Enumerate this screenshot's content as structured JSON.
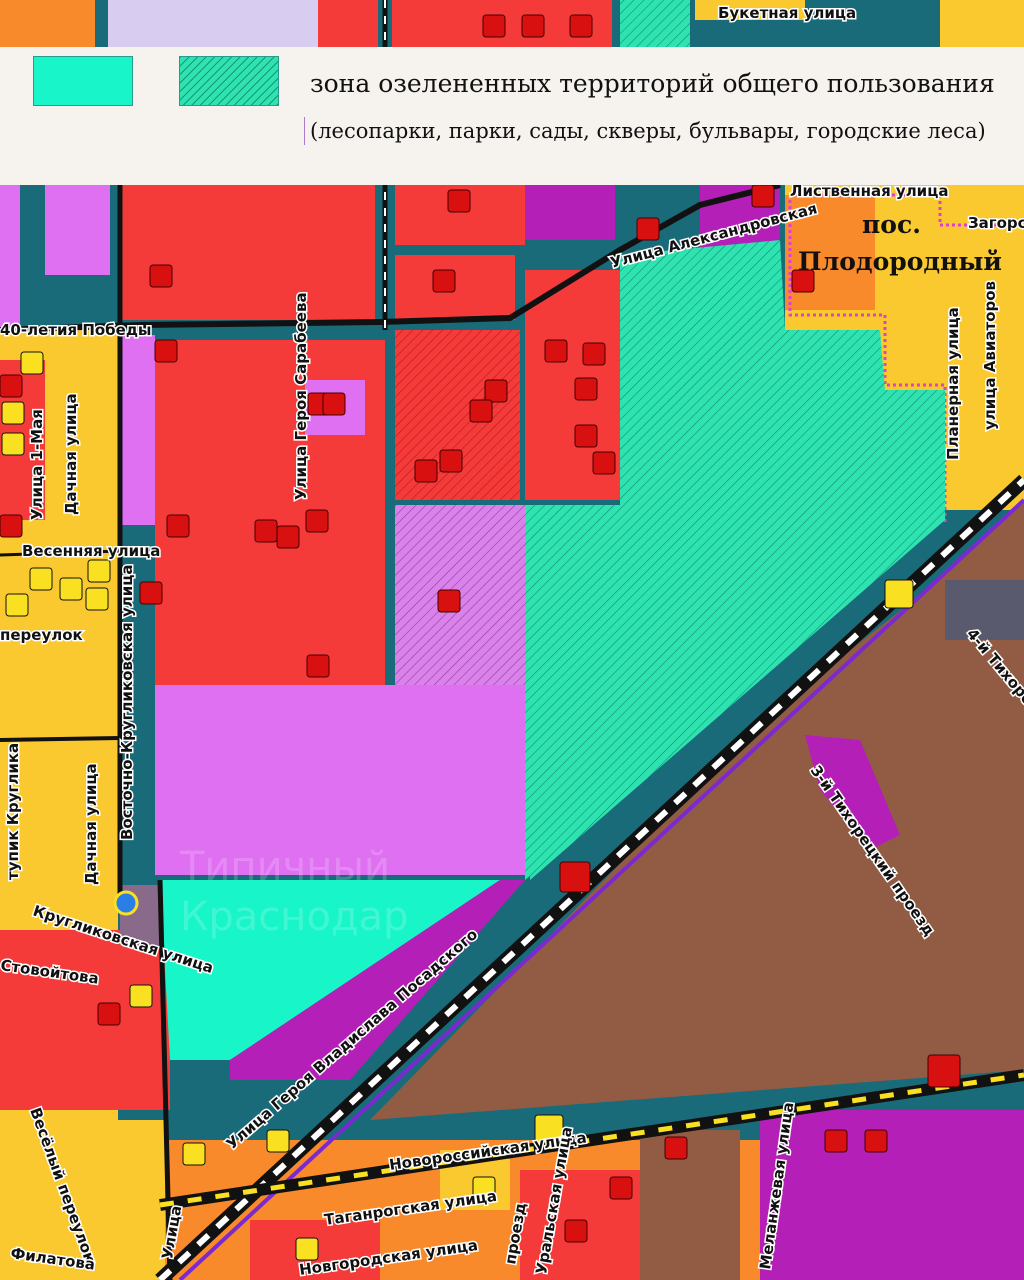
{
  "legend": {
    "title": "зона озелененных территорий общего пользования",
    "subtitle": "(лесопарки, парки, сады, скверы, бульвары, городские леса)",
    "swatches": [
      {
        "name": "solid",
        "color": "#18f5c8"
      },
      {
        "name": "hatched",
        "color": "#2fe3b0"
      }
    ]
  },
  "colors": {
    "water": "#1a6b7a",
    "residential": "#f9c92f",
    "public": "#fa3c3c",
    "commercial": "#e070f2",
    "green": "#18f5c8",
    "industrial": "#925c44",
    "orange": "#f77b2a",
    "purple": "#b31fb7"
  },
  "settlement": {
    "line1": "пос.",
    "line2": "Плодородный"
  },
  "streets": {
    "s1": "Букетная улица",
    "s2": "Лиственная улица",
    "s3": "Загорс",
    "s4": "Улица Александровская",
    "s5": "40-летия Победы",
    "s6": "Улица Героя Сарабеева",
    "s7": "Улица 1-Мая",
    "s8": "Дачная улица",
    "s9": "Весенняя улица",
    "s10": "переулок",
    "s11": "Восточно-Кругликовская улица",
    "s12": "тупик Круглика",
    "s13": "Дачная улица",
    "s14": "Кругликовская улица",
    "s15": "Стовойтова",
    "s16": "Весёлый переулок",
    "s17": "Филатова",
    "s18": "Улица Героя Владислава Посадского",
    "s19": "Планерная улица",
    "s20": "улица Авиаторов",
    "s21": "4-й Тихорец",
    "s22": "3-й Тихорецкий проезд",
    "s23": "Новороссийская улица",
    "s24": "Таганрогская улица",
    "s25": "Новгородская улица",
    "s26": "Уральская улица",
    "s27": "проезд",
    "s28": "Меланжевая улица",
    "s29": "Улица"
  },
  "watermark": {
    "line1": "Типичный",
    "line2": "Краснодар"
  }
}
